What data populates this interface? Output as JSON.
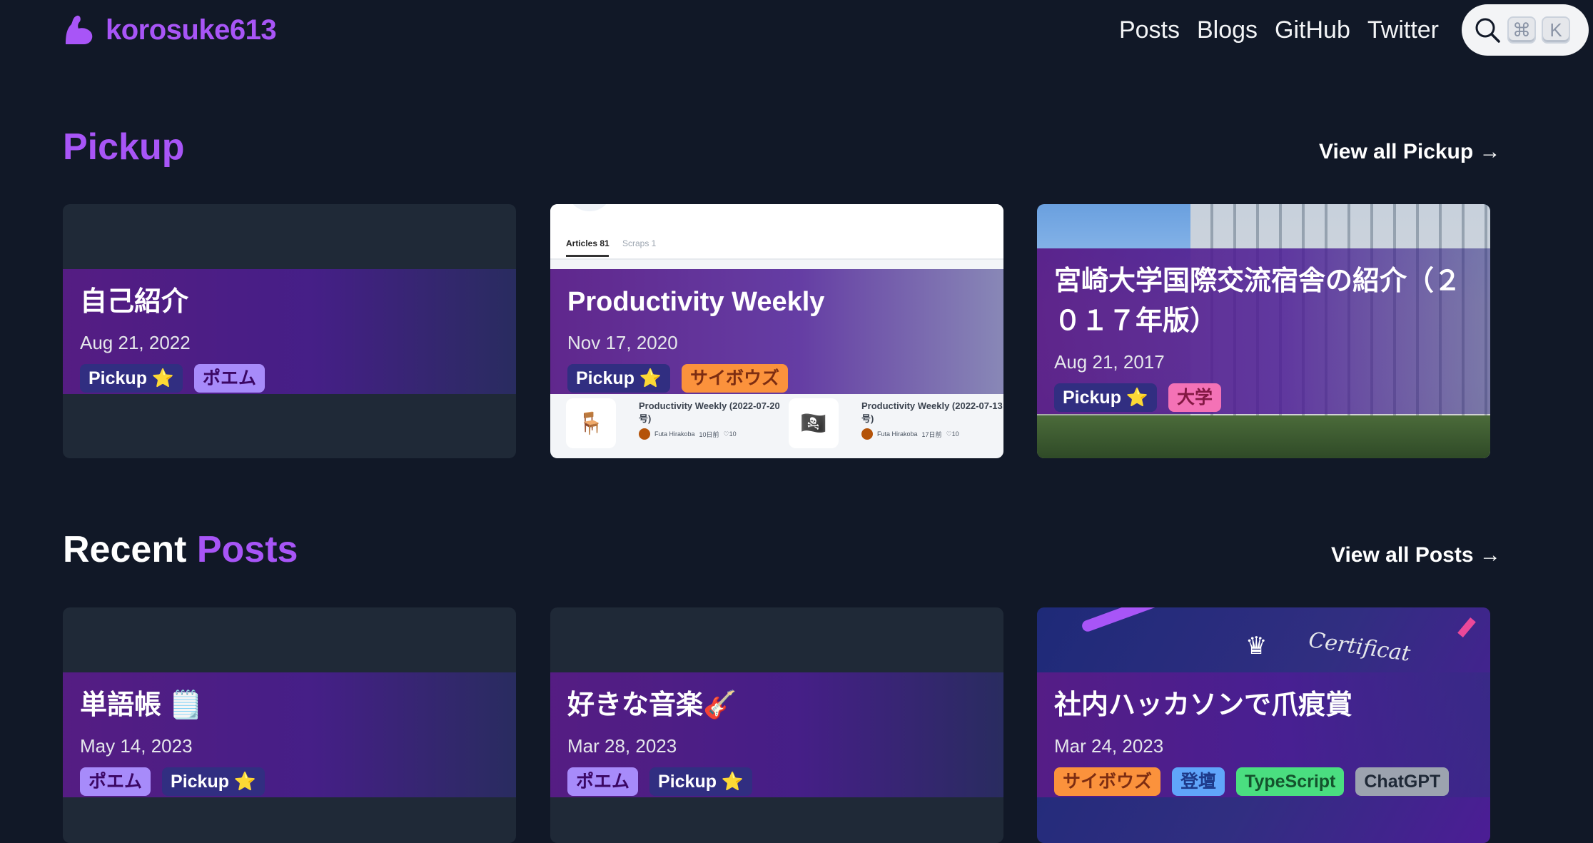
{
  "header": {
    "site_name": "korosuke613",
    "nav": [
      "Posts",
      "Blogs",
      "GitHub",
      "Twitter"
    ],
    "search_keys": [
      "⌘",
      "K"
    ]
  },
  "pickup": {
    "title": "Pickup",
    "view_all": "View all Pickup →",
    "cards": [
      {
        "title": "自己紹介",
        "date": "Aug 21, 2022",
        "tags": [
          "Pickup ⭐",
          "ポエム"
        ]
      },
      {
        "title": "Productivity Weekly",
        "date": "Nov 17, 2020",
        "tags": [
          "Pickup ⭐",
          "サイボウズ"
        ],
        "image": {
          "tab_active": "Articles 81",
          "tab_inactive": "Scraps 1",
          "items": [
            {
              "title": "Productivity Weekly (2022-07-20号)",
              "author": "Futa Hirakoba",
              "ago": "10日前",
              "likes": "♡10",
              "icon": "🪑"
            },
            {
              "title": "Productivity Weekly (2022-07-13号)",
              "author": "Futa Hirakoba",
              "ago": "17日前",
              "likes": "♡10",
              "icon": "🏴‍☠️"
            }
          ]
        }
      },
      {
        "title": "宮崎大学国際交流宿舎の紹介（２０１７年版）",
        "date": "Aug 21, 2017",
        "tags": [
          "Pickup ⭐",
          "大学"
        ]
      }
    ]
  },
  "recent": {
    "title_white": "Recent",
    "title_accent": "Posts",
    "view_all": "View all Posts →",
    "cards": [
      {
        "title": "単語帳 🗒️",
        "date": "May 14, 2023",
        "tags": [
          "ポエム",
          "Pickup ⭐"
        ]
      },
      {
        "title": "好きな音楽🎸",
        "date": "Mar 28, 2023",
        "tags": [
          "ポエム",
          "Pickup ⭐"
        ]
      },
      {
        "title": "社内ハッカソンで爪痕賞",
        "date": "Mar 24, 2023",
        "tags": [
          "サイボウズ",
          "登壇",
          "TypeScript",
          "ChatGPT"
        ],
        "image_text": "Certificat"
      }
    ]
  },
  "colors": {
    "background": "#111827",
    "accent": "#a855f7",
    "card": "#1f2937"
  }
}
